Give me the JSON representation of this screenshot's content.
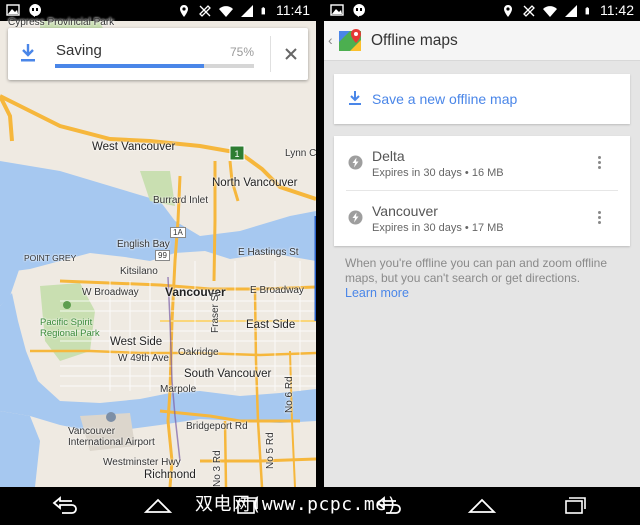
{
  "left": {
    "status": {
      "time": "11:41"
    },
    "saving": {
      "title": "Saving",
      "percent_text": "75%",
      "progress": 0.75
    },
    "map_labels": {
      "province_park": "Cypress Provincial Park",
      "west_vancouver": "West Vancouver",
      "lynn_canyon": "Lynn Ca",
      "north_vancouver": "North Vancouver",
      "burrard_inlet": "Burrard Inlet",
      "english_bay": "English Bay",
      "hwy_1a": "1A",
      "hwy_99": "99",
      "kitsilano": "Kitsilano",
      "e_hastings": "E Hastings St",
      "vancouver": "Vancouver",
      "e_broadway": "E Broadway",
      "w_broadway": "W Broadway",
      "point_grey": "POINT GREY",
      "pacific_spirit": "Pacific Spirit Regional Park",
      "west_side": "West Side",
      "w_49th": "W 49th Ave",
      "oakridge": "Oakridge",
      "fraser_st": "Fraser St",
      "east_side": "East Side",
      "south_vancouver": "South Vancouver",
      "marpole": "Marpole",
      "airport": "Vancouver International Airport",
      "bridgeport": "Bridgeport Rd",
      "no6": "No 6 Rd",
      "richmond": "Richmond",
      "westminster": "Westminster Hwy",
      "rd_no5": "No 5 Rd",
      "rd_no3": "No 3 Rd"
    }
  },
  "right": {
    "status": {
      "time": "11:42"
    },
    "title": "Offline maps",
    "save_new": "Save a new offline map",
    "maps": [
      {
        "name": "Delta",
        "meta": "Expires in 30 days • 16 MB"
      },
      {
        "name": "Vancouver",
        "meta": "Expires in 30 days • 17 MB"
      }
    ],
    "info_text": "When you're offline you can pan and zoom offline maps, but you can't search or get directions.",
    "learn_more": "Learn more"
  },
  "watermark": "双电网(www.pcpc.me)",
  "colors": {
    "accent": "#4a86e8",
    "progress_track": "#d6d6d6",
    "map_road": "#f6b73c"
  }
}
